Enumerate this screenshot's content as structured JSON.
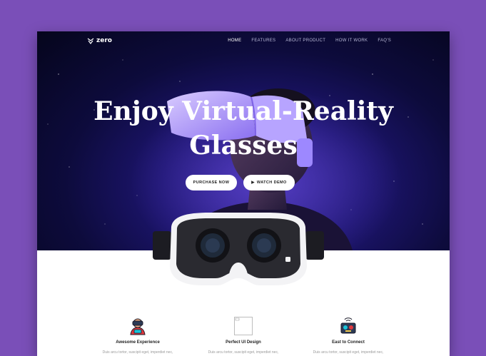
{
  "brand": {
    "name": "zero"
  },
  "nav": {
    "items": [
      {
        "label": "HOME",
        "active": true
      },
      {
        "label": "FEATURES",
        "active": false
      },
      {
        "label": "ABOUT PRODUCT",
        "active": false
      },
      {
        "label": "HOW IT WORK",
        "active": false
      },
      {
        "label": "FAQ'S",
        "active": false
      }
    ]
  },
  "hero": {
    "title_line1": "Enjoy Virtual-Reality",
    "title_line2": "Glasses",
    "purchase_label": "PURCHASE NOW",
    "watch_label": "WATCH DEMO",
    "watch_icon": "play-icon"
  },
  "features": [
    {
      "title": "Awesome Experience",
      "desc": "Duis arcu tortor, suscipit eget, imperdiet nec,",
      "icon": "vr-user-icon"
    },
    {
      "title": "Perfect UI Design",
      "desc": "Duis arcu tortor, suscipit eget, imperdiet nec,",
      "icon": "broken-image-icon"
    },
    {
      "title": "East to Connect",
      "desc": "Duis arcu tortor, suscipit eget, imperdiet nec,",
      "icon": "robot-connect-icon"
    }
  ],
  "colors": {
    "background": "#7a4fb8",
    "hero_dark": "#0d0b3c",
    "hero_glow": "#3a2aa0",
    "accent": "#19c3d8"
  }
}
